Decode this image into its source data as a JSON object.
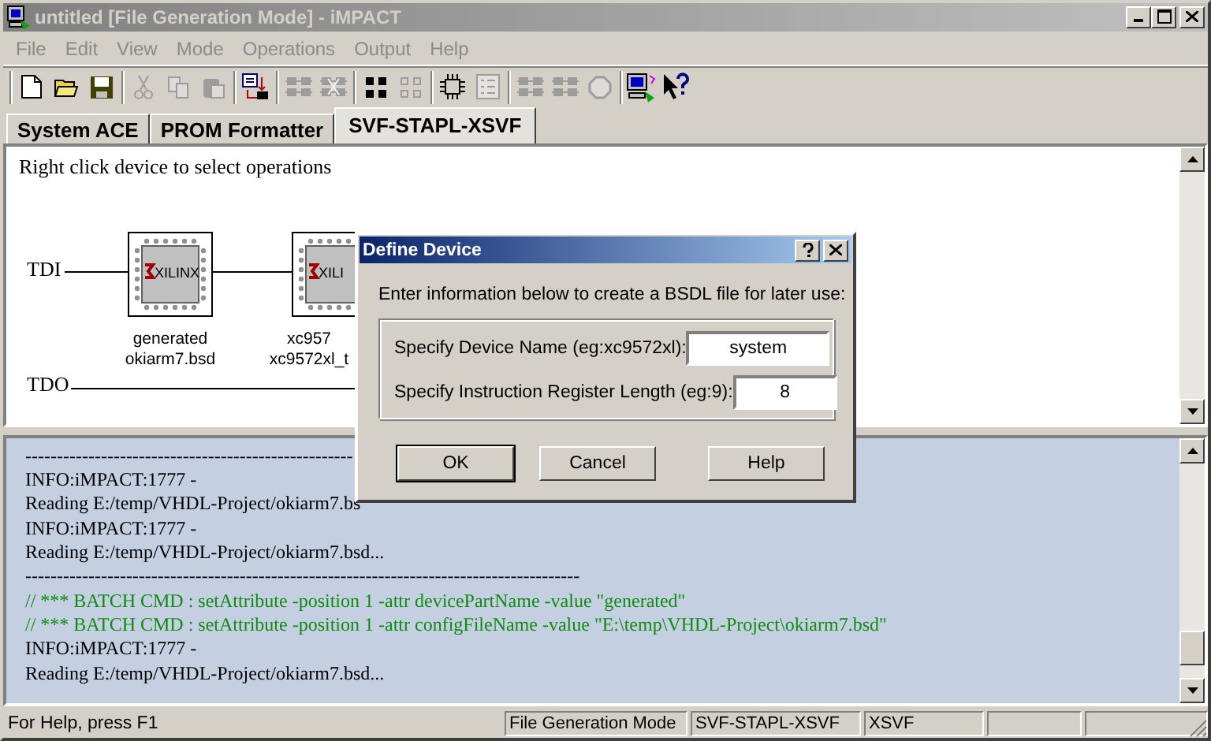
{
  "window": {
    "title": "untitled [File Generation Mode]  - iMPACT",
    "active": false
  },
  "menu": [
    {
      "label": "File",
      "disabled": true
    },
    {
      "label": "Edit",
      "disabled": true
    },
    {
      "label": "View",
      "disabled": true
    },
    {
      "label": "Mode",
      "disabled": true
    },
    {
      "label": "Operations",
      "disabled": true
    },
    {
      "label": "Output",
      "disabled": true
    },
    {
      "label": "Help",
      "disabled": true
    }
  ],
  "toolbar": [
    [
      {
        "kind": "new",
        "disabled": false
      },
      {
        "kind": "open",
        "disabled": false
      },
      {
        "kind": "save",
        "disabled": false
      }
    ],
    [
      {
        "kind": "cut",
        "disabled": true
      },
      {
        "kind": "copy",
        "disabled": true
      },
      {
        "kind": "paste",
        "disabled": true
      }
    ],
    [
      {
        "kind": "generate",
        "disabled": false
      }
    ],
    [
      {
        "kind": "chain",
        "disabled": true
      },
      {
        "kind": "chain-cross",
        "disabled": true
      }
    ],
    [
      {
        "kind": "grid",
        "disabled": false
      },
      {
        "kind": "grid",
        "disabled": true
      }
    ],
    [
      {
        "kind": "chip",
        "disabled": false
      },
      {
        "kind": "list",
        "disabled": true
      }
    ],
    [
      {
        "kind": "chain",
        "disabled": true
      },
      {
        "kind": "chain",
        "disabled": true
      },
      {
        "kind": "gear",
        "disabled": true
      }
    ],
    [
      {
        "kind": "computer",
        "disabled": false
      },
      {
        "kind": "help-pointer",
        "disabled": false
      }
    ]
  ],
  "tabs": [
    {
      "label": "System ACE",
      "selected": false
    },
    {
      "label": "PROM Formatter",
      "selected": false
    },
    {
      "label": "SVF-STAPL-XSVF",
      "selected": true
    }
  ],
  "chain_view": {
    "hint": "Right click device to select operations",
    "tdi": "TDI",
    "tdo": "TDO",
    "devices": [
      {
        "logo": "XILINX",
        "name": "generated",
        "file": "okiarm7.bsd"
      },
      {
        "logo": "XILI",
        "name": "xc957",
        "file": "xc9572xl_t"
      }
    ]
  },
  "log": [
    {
      "kind": "info",
      "text": "----------------------------------------------------"
    },
    {
      "kind": "info",
      "text": "INFO:iMPACT:1777 -"
    },
    {
      "kind": "info",
      "text": "Reading E:/temp/VHDL-Project/okiarm7.bs"
    },
    {
      "kind": "info",
      "text": "INFO:iMPACT:1777 -"
    },
    {
      "kind": "info",
      "text": "Reading E:/temp/VHDL-Project/okiarm7.bsd..."
    },
    {
      "kind": "info",
      "text": "----------------------------------------------------------------------------------------"
    },
    {
      "kind": "batch",
      "text": "// *** BATCH CMD : setAttribute -position 1 -attr devicePartName -value \"generated\""
    },
    {
      "kind": "batch",
      "text": "// *** BATCH CMD : setAttribute -position 1 -attr configFileName -value \"E:\\temp\\VHDL-Project\\okiarm7.bsd\""
    },
    {
      "kind": "info",
      "text": "INFO:iMPACT:1777 -"
    },
    {
      "kind": "info",
      "text": "Reading E:/temp/VHDL-Project/okiarm7.bsd..."
    }
  ],
  "dialog": {
    "title": "Define Device",
    "instruction": "Enter information below to create a BSDL file for later use:",
    "fields": [
      {
        "label": "Specify Device Name (eg:xc9572xl):",
        "value": "system"
      },
      {
        "label": "Specify Instruction Register Length (eg:9):",
        "value": "8"
      }
    ],
    "buttons": [
      {
        "label": "OK",
        "default": true
      },
      {
        "label": "Cancel",
        "default": false
      },
      {
        "label": "Help",
        "default": false
      }
    ]
  },
  "status_bar": {
    "help": "For Help, press F1",
    "panels": [
      "File Generation Mode",
      "SVF-STAPL-XSVF",
      "XSVF"
    ]
  }
}
